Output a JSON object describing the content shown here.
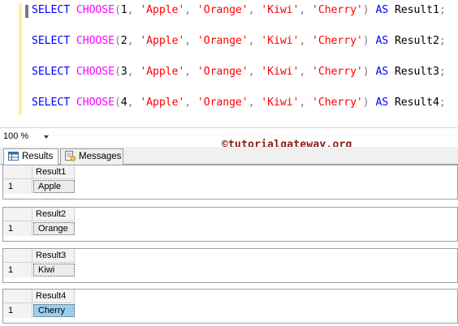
{
  "editor": {
    "lines": [
      {
        "select": "SELECT",
        "fn": "CHOOSE",
        "index": "1",
        "strings": [
          "'Apple'",
          "'Orange'",
          "'Kiwi'",
          "'Cherry'"
        ],
        "as": "AS",
        "alias": "Result1"
      },
      {
        "select": "SELECT",
        "fn": "CHOOSE",
        "index": "2",
        "strings": [
          "'Apple'",
          "'Orange'",
          "'Kiwi'",
          "'Cherry'"
        ],
        "as": "AS",
        "alias": "Result2"
      },
      {
        "select": "SELECT",
        "fn": "CHOOSE",
        "index": "3",
        "strings": [
          "'Apple'",
          "'Orange'",
          "'Kiwi'",
          "'Cherry'"
        ],
        "as": "AS",
        "alias": "Result3"
      },
      {
        "select": "SELECT",
        "fn": "CHOOSE",
        "index": "4",
        "strings": [
          "'Apple'",
          "'Orange'",
          "'Kiwi'",
          "'Cherry'"
        ],
        "as": "AS",
        "alias": "Result4"
      }
    ]
  },
  "zoom": {
    "value": "100 %"
  },
  "watermark": "©tutorialgateway.org",
  "tabs": [
    {
      "label": "Results",
      "icon": "grid-icon"
    },
    {
      "label": "Messages",
      "icon": "messages-icon"
    }
  ],
  "results": [
    {
      "column": "Result1",
      "row_number": "1",
      "value": "Apple",
      "selected": false
    },
    {
      "column": "Result2",
      "row_number": "1",
      "value": "Orange",
      "selected": false
    },
    {
      "column": "Result3",
      "row_number": "1",
      "value": "Kiwi",
      "selected": false
    },
    {
      "column": "Result4",
      "row_number": "1",
      "value": "Cherry",
      "selected": true
    }
  ],
  "colors": {
    "keyword": "#0000ff",
    "function": "#ff00ff",
    "string": "#ff0000",
    "punctuation": "#808080",
    "watermark": "#8b1a1a",
    "selected_cell": "#99d0f0"
  }
}
